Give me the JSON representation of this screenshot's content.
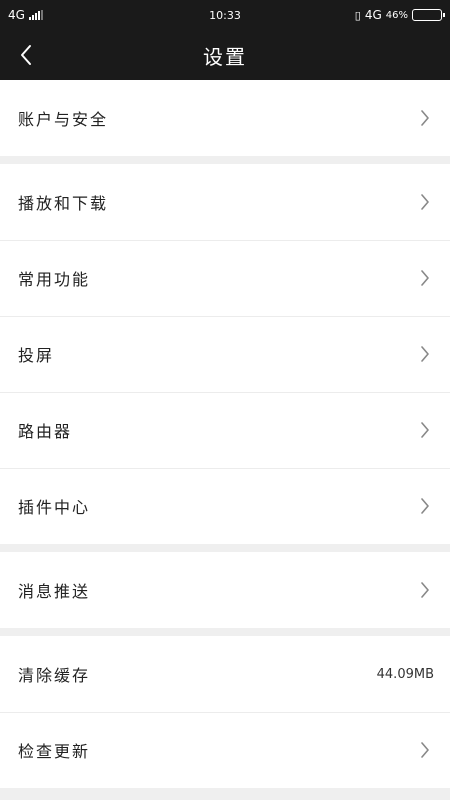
{
  "status_bar": {
    "network_left": "4G",
    "time": "10:33",
    "network_right": "4G",
    "battery_percent": "46%",
    "battery_level": "4"
  },
  "header": {
    "title": "设置"
  },
  "groups": [
    {
      "items": [
        {
          "label": "账户与安全"
        }
      ]
    },
    {
      "items": [
        {
          "label": "播放和下载"
        },
        {
          "label": "常用功能"
        },
        {
          "label": "投屏"
        },
        {
          "label": "路由器"
        },
        {
          "label": "插件中心"
        }
      ]
    },
    {
      "items": [
        {
          "label": "消息推送"
        }
      ]
    },
    {
      "items": [
        {
          "label": "清除缓存",
          "value": "44.09MB"
        },
        {
          "label": "检查更新"
        }
      ]
    }
  ]
}
